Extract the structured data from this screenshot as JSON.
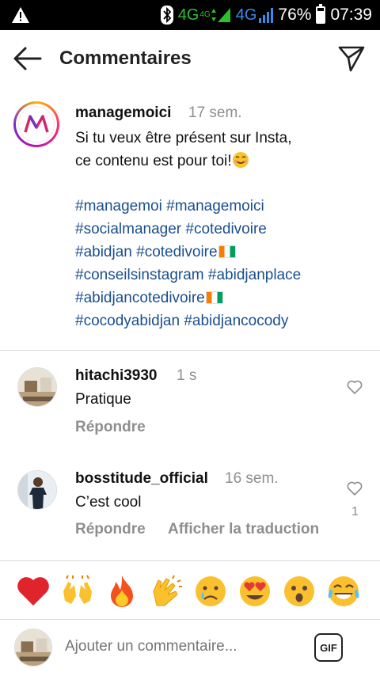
{
  "status_bar": {
    "network1": "4G",
    "network1_small": "4G",
    "network2": "4G",
    "battery": "76%",
    "time": "07:39",
    "icons": [
      "warning-icon",
      "bluetooth-icon",
      "signal-icon",
      "battery-icon"
    ]
  },
  "header": {
    "title": "Commentaires",
    "back_icon": "arrow-left-icon",
    "send_icon": "paper-plane-icon"
  },
  "caption": {
    "username": "managemoici",
    "time": "17 sem.",
    "line1": "Si tu veux être présent sur Insta,",
    "line2": "ce contenu est pour toi!",
    "tags_line1": "#managemoi #managemoici",
    "tags_line2": "#socialmanager #cotedivoire",
    "tags_line3": "#abidjan #cotedivoire",
    "tags_line4": "#conseilsinstagram #abidjanplace",
    "tags_line5": "#abidjancotedivoire",
    "tags_line6": "#cocodyabidjan #abidjancocody"
  },
  "comments": [
    {
      "username": "hitachi3930",
      "time": "1 s",
      "text": "Pratique",
      "reply": "Répondre"
    },
    {
      "username": "bosstitude_official",
      "time": "16 sem.",
      "text": "C’est cool",
      "reply": "Répondre",
      "translate": "Afficher la traduction",
      "likes": "1"
    }
  ],
  "emoji_bar": [
    "red-heart",
    "raising-hands",
    "fire",
    "clapping-hands",
    "crying-face",
    "heart-eyes-face",
    "surprised-face",
    "tears-of-joy-face"
  ],
  "input": {
    "placeholder": "Ajouter un commentaire...",
    "gif_label": "GIF"
  },
  "colors": {
    "hashtag": "#1a4f8e",
    "muted": "#8e8e8e",
    "status_green": "#2bc12b",
    "status_blue": "#3a8ae8"
  }
}
